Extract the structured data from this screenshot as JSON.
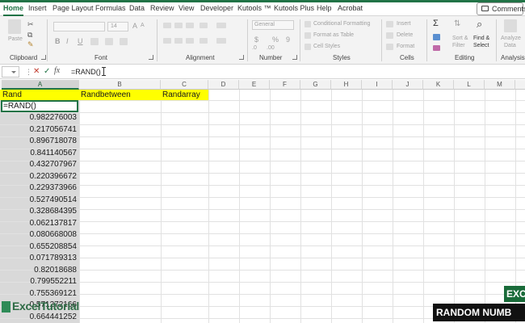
{
  "menu": {
    "tabs": [
      {
        "label": "Home",
        "active": true
      },
      {
        "label": "Insert"
      },
      {
        "label": "Page Layout"
      },
      {
        "label": "Formulas"
      },
      {
        "label": "Data"
      },
      {
        "label": "Review"
      },
      {
        "label": "View"
      },
      {
        "label": "Developer"
      },
      {
        "label": "Kutools ™"
      },
      {
        "label": "Kutools Plus"
      },
      {
        "label": "Help"
      },
      {
        "label": "Acrobat"
      }
    ],
    "comments_label": "Comments"
  },
  "ribbon": {
    "groups": {
      "clipboard": "Clipboard",
      "font": "Font",
      "alignment": "Alignment",
      "number": "Number",
      "styles": "Styles",
      "cells": "Cells",
      "editing": "Editing",
      "analysis": "Analysis"
    },
    "clipboard": {
      "paste": "Paste"
    },
    "font": {
      "size": "14",
      "bold": "B",
      "italic": "I",
      "underline": "U",
      "grow": "A",
      "shrink": "A"
    },
    "number": {
      "format": "General",
      "currency": "$",
      "percent": "%",
      "comma": "9",
      "inc": ".0",
      "dec": ".00"
    },
    "styles": {
      "conditional": "Conditional Formatting",
      "table": "Format as Table",
      "cell": "Cell Styles"
    },
    "cells": {
      "insert": "Insert",
      "delete": "Delete",
      "format": "Format"
    },
    "editing": {
      "sigma": "Σ",
      "sort": "Sort &",
      "filter": "Filter",
      "find": "Find &",
      "select": "Select"
    },
    "analysis": {
      "analyze": "Analyze",
      "data": "Data"
    }
  },
  "formula_bar": {
    "value": "=RAND()",
    "cancel_icon": "close-icon",
    "enter_icon": "check-icon",
    "fx": "fx"
  },
  "columns": [
    "A",
    "B",
    "C",
    "D",
    "E",
    "F",
    "G",
    "H",
    "I",
    "J",
    "K",
    "L",
    "M",
    "N"
  ],
  "headers": {
    "a": "Rand",
    "b": "Randbetween",
    "c": "Randarray"
  },
  "active_cell_value": "=RAND()",
  "rand_values": [
    "0.982276003",
    "0.217056741",
    "0.896718078",
    "0.841140567",
    "0.432707967",
    "0.220396672",
    "0.229373966",
    "0.527490514",
    "0.328684395",
    "0.062137817",
    "0.080668008",
    "0.655208854",
    "0.071789313",
    "0.82018688",
    "0.799552211",
    "0.755369121",
    "0.571272166",
    "0.664441252"
  ],
  "watermark": {
    "brand": "ExcelTutorial"
  },
  "overlay": {
    "badge": "EXC",
    "banner": "RANDOM NUMB"
  },
  "colors": {
    "accent": "#217346",
    "header_fill": "#ffff00"
  }
}
